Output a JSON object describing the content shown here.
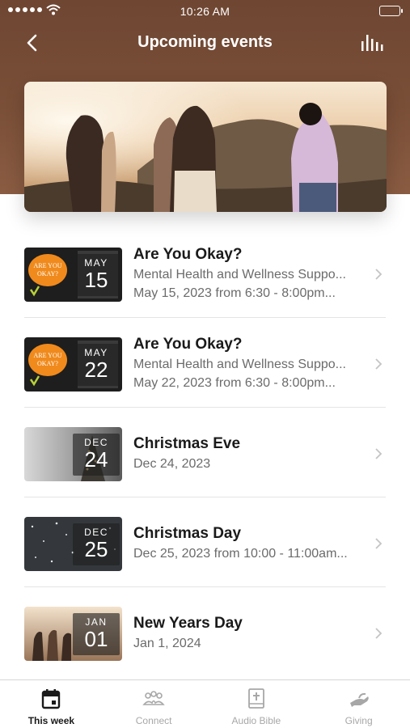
{
  "status_bar": {
    "time": "10:26 AM"
  },
  "nav": {
    "title": "Upcoming events"
  },
  "events": [
    {
      "month": "MAY",
      "day": "15",
      "title": "Are You Okay?",
      "subtitle": "Mental Health and Wellness Suppo...",
      "date_text": "May 15, 2023 from 6:30 - 8:00pm...",
      "thumb_text": "ARE YOU OKAY?"
    },
    {
      "month": "MAY",
      "day": "22",
      "title": "Are You Okay?",
      "subtitle": "Mental Health and Wellness Suppo...",
      "date_text": "May 22, 2023 from 6:30 - 8:00pm...",
      "thumb_text": "ARE YOU OKAY?"
    },
    {
      "month": "DEC",
      "day": "24",
      "title": "Christmas Eve",
      "date_text": "Dec 24, 2023"
    },
    {
      "month": "DEC",
      "day": "25",
      "title": "Christmas Day",
      "date_text": "Dec 25, 2023 from 10:00 - 11:00am..."
    },
    {
      "month": "JAN",
      "day": "01",
      "title": "New Years Day",
      "date_text": "Jan 1, 2024"
    }
  ],
  "tabs": [
    {
      "label": "This week",
      "icon": "calendar-icon",
      "active": true
    },
    {
      "label": "Connect",
      "icon": "people-icon",
      "active": false
    },
    {
      "label": "Audio Bible",
      "icon": "bible-icon",
      "active": false
    },
    {
      "label": "Giving",
      "icon": "giving-hand-icon",
      "active": false
    }
  ],
  "colors": {
    "header": "#7a4f38",
    "accent_orange": "#f08a1c",
    "inactive_tab": "#a7a7a7"
  }
}
